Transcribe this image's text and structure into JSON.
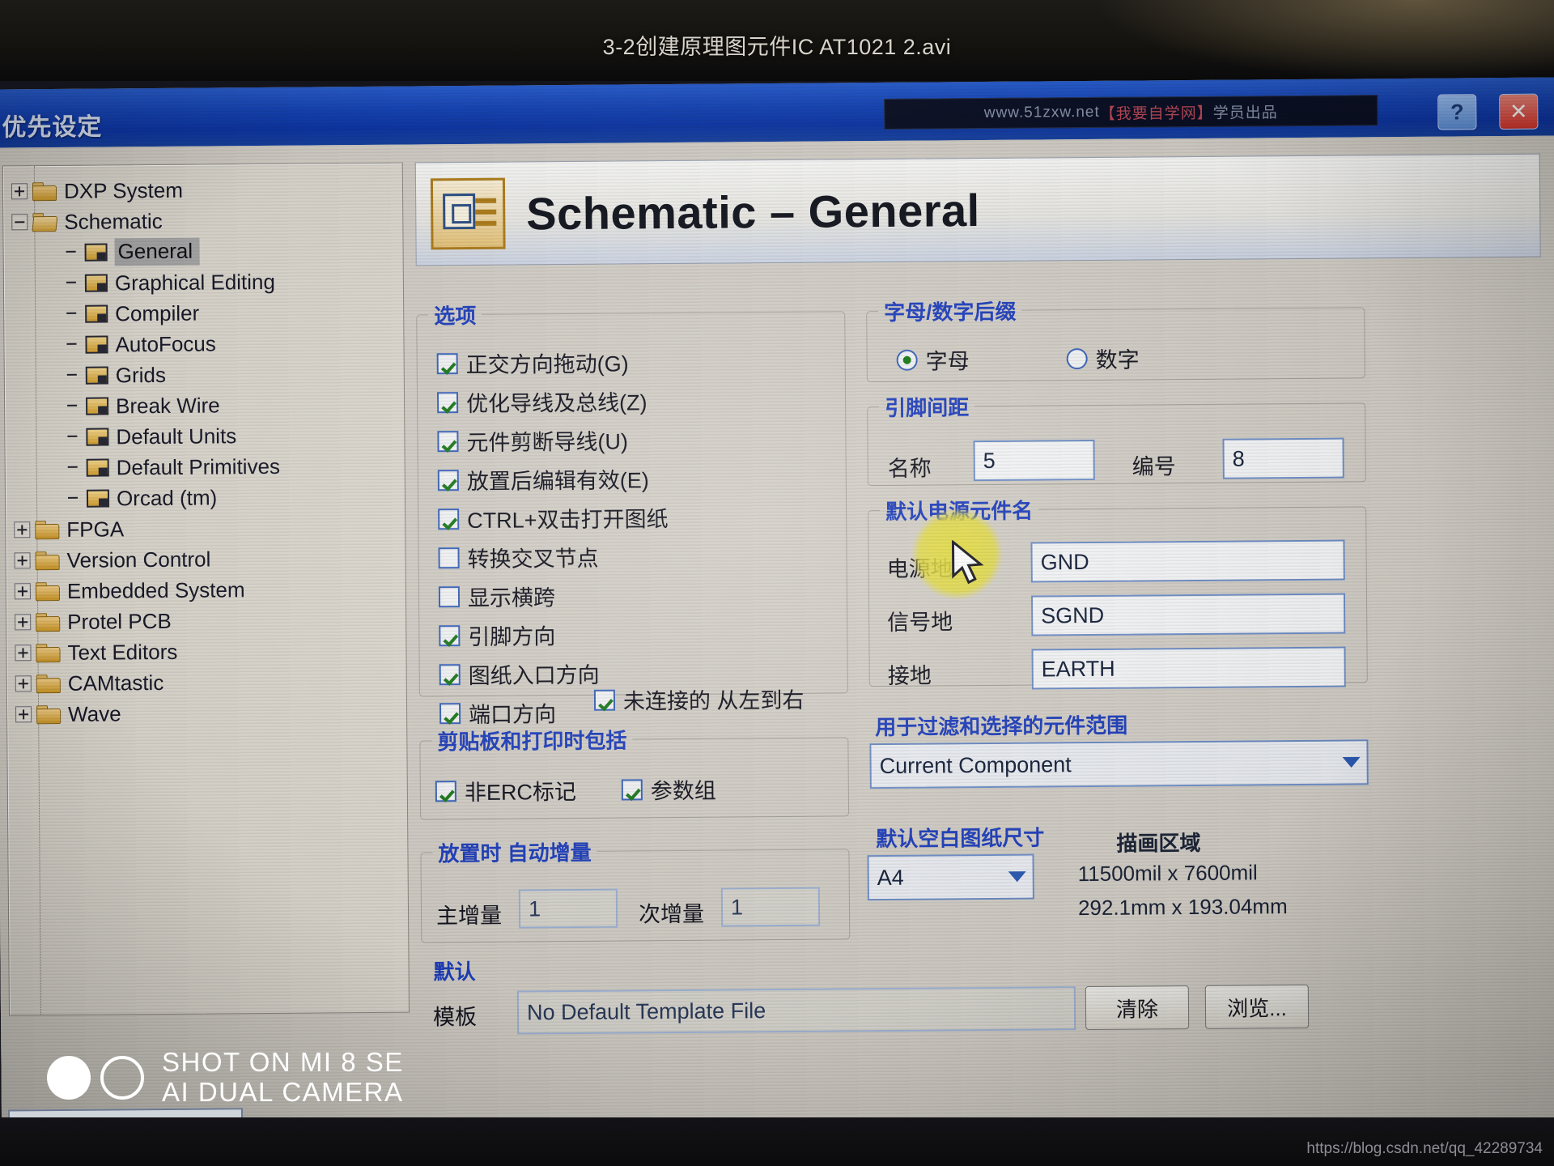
{
  "photo": {
    "video_title": "3-2创建原理图元件IC AT1021 2.avi",
    "camera_watermark_line1": "SHOT ON MI 8 SE",
    "camera_watermark_line2": "AI DUAL CAMERA",
    "blog_url": "https://blog.csdn.net/qq_42289734"
  },
  "window": {
    "title": "优先设定",
    "watermark_text": "www.51zxw.net【我要自学网】学员出品",
    "help_button": "?",
    "close_button": "✕"
  },
  "tree": {
    "items": [
      {
        "label": "DXP System",
        "level": 0,
        "icon": "folder-icon",
        "expander": "plus",
        "selected": false
      },
      {
        "label": "Schematic",
        "level": 0,
        "icon": "folder-open-icon",
        "expander": "minus",
        "selected": false
      },
      {
        "label": "General",
        "level": 1,
        "icon": "page-icon",
        "expander": "none",
        "selected": true
      },
      {
        "label": "Graphical Editing",
        "level": 1,
        "icon": "page-icon",
        "expander": "none",
        "selected": false
      },
      {
        "label": "Compiler",
        "level": 1,
        "icon": "page-icon",
        "expander": "none",
        "selected": false
      },
      {
        "label": "AutoFocus",
        "level": 1,
        "icon": "page-icon",
        "expander": "none",
        "selected": false
      },
      {
        "label": "Grids",
        "level": 1,
        "icon": "page-icon",
        "expander": "none",
        "selected": false
      },
      {
        "label": "Break Wire",
        "level": 1,
        "icon": "page-icon",
        "expander": "none",
        "selected": false
      },
      {
        "label": "Default Units",
        "level": 1,
        "icon": "page-icon",
        "expander": "none",
        "selected": false
      },
      {
        "label": "Default Primitives",
        "level": 1,
        "icon": "page-icon",
        "expander": "none",
        "selected": false
      },
      {
        "label": "Orcad (tm)",
        "level": 1,
        "icon": "page-icon",
        "expander": "none",
        "selected": false
      },
      {
        "label": "FPGA",
        "level": 0,
        "icon": "folder-icon",
        "expander": "plus",
        "selected": false
      },
      {
        "label": "Version Control",
        "level": 0,
        "icon": "folder-icon",
        "expander": "plus",
        "selected": false
      },
      {
        "label": "Embedded System",
        "level": 0,
        "icon": "folder-icon",
        "expander": "plus",
        "selected": false
      },
      {
        "label": "Protel PCB",
        "level": 0,
        "icon": "folder-icon",
        "expander": "plus",
        "selected": false
      },
      {
        "label": "Text Editors",
        "level": 0,
        "icon": "folder-icon",
        "expander": "plus",
        "selected": false
      },
      {
        "label": "CAMtastic",
        "level": 0,
        "icon": "folder-icon",
        "expander": "plus",
        "selected": false
      },
      {
        "label": "Wave",
        "level": 0,
        "icon": "folder-icon",
        "expander": "plus",
        "selected": false
      }
    ]
  },
  "page": {
    "heading": "Schematic – General"
  },
  "options": {
    "legend": "选项",
    "checkboxes": [
      {
        "label": "正交方向拖动(G)",
        "checked": true
      },
      {
        "label": "优化导线及总线(Z)",
        "checked": true
      },
      {
        "label": "元件剪断导线(U)",
        "checked": true
      },
      {
        "label": "放置后编辑有效(E)",
        "checked": true
      },
      {
        "label": "CTRL+双击打开图纸",
        "checked": true
      },
      {
        "label": "转换交叉节点",
        "checked": false
      },
      {
        "label": "显示横跨",
        "checked": false
      },
      {
        "label": "引脚方向",
        "checked": true
      },
      {
        "label": "图纸入口方向",
        "checked": true
      },
      {
        "label": "端口方向",
        "checked": true
      }
    ],
    "side_checkbox": {
      "label": "未连接的 从左到右",
      "checked": true
    }
  },
  "clipboard": {
    "legend": "剪贴板和打印时包括",
    "checkboxes": [
      {
        "label": "非ERC标记",
        "checked": true
      },
      {
        "label": "参数组",
        "checked": true
      }
    ]
  },
  "autoincrement": {
    "legend": "放置时 自动增量",
    "primary_label": "主增量",
    "primary_value": "1",
    "secondary_label": "次增量",
    "secondary_value": "1"
  },
  "alpha_numeric_suffix": {
    "legend": "字母/数字后缀",
    "options": [
      {
        "label": "字母",
        "selected": true
      },
      {
        "label": "数字",
        "selected": false
      }
    ]
  },
  "pin_margin": {
    "legend": "引脚间距",
    "name_label": "名称",
    "name_value": "5",
    "number_label": "编号",
    "number_value": "8"
  },
  "default_power_names": {
    "legend": "默认电源元件名",
    "rows": [
      {
        "label": "电源地",
        "value": "GND"
      },
      {
        "label": "信号地",
        "value": "SGND"
      },
      {
        "label": "接地",
        "value": "EARTH"
      }
    ]
  },
  "filter_scope": {
    "legend": "用于过滤和选择的元件范围",
    "value": "Current Component"
  },
  "default_sheet_size": {
    "legend": "默认空白图纸尺寸",
    "value": "A4",
    "draw_area_label": "描画区域",
    "draw_area_imperial": "11500mil x 7600mil",
    "draw_area_metric": "292.1mm x 193.04mm"
  },
  "defaults": {
    "legend": "默认",
    "template_label": "模板",
    "template_value": "No Default Template File",
    "clear_button": "清除",
    "browse_button": "浏览..."
  }
}
